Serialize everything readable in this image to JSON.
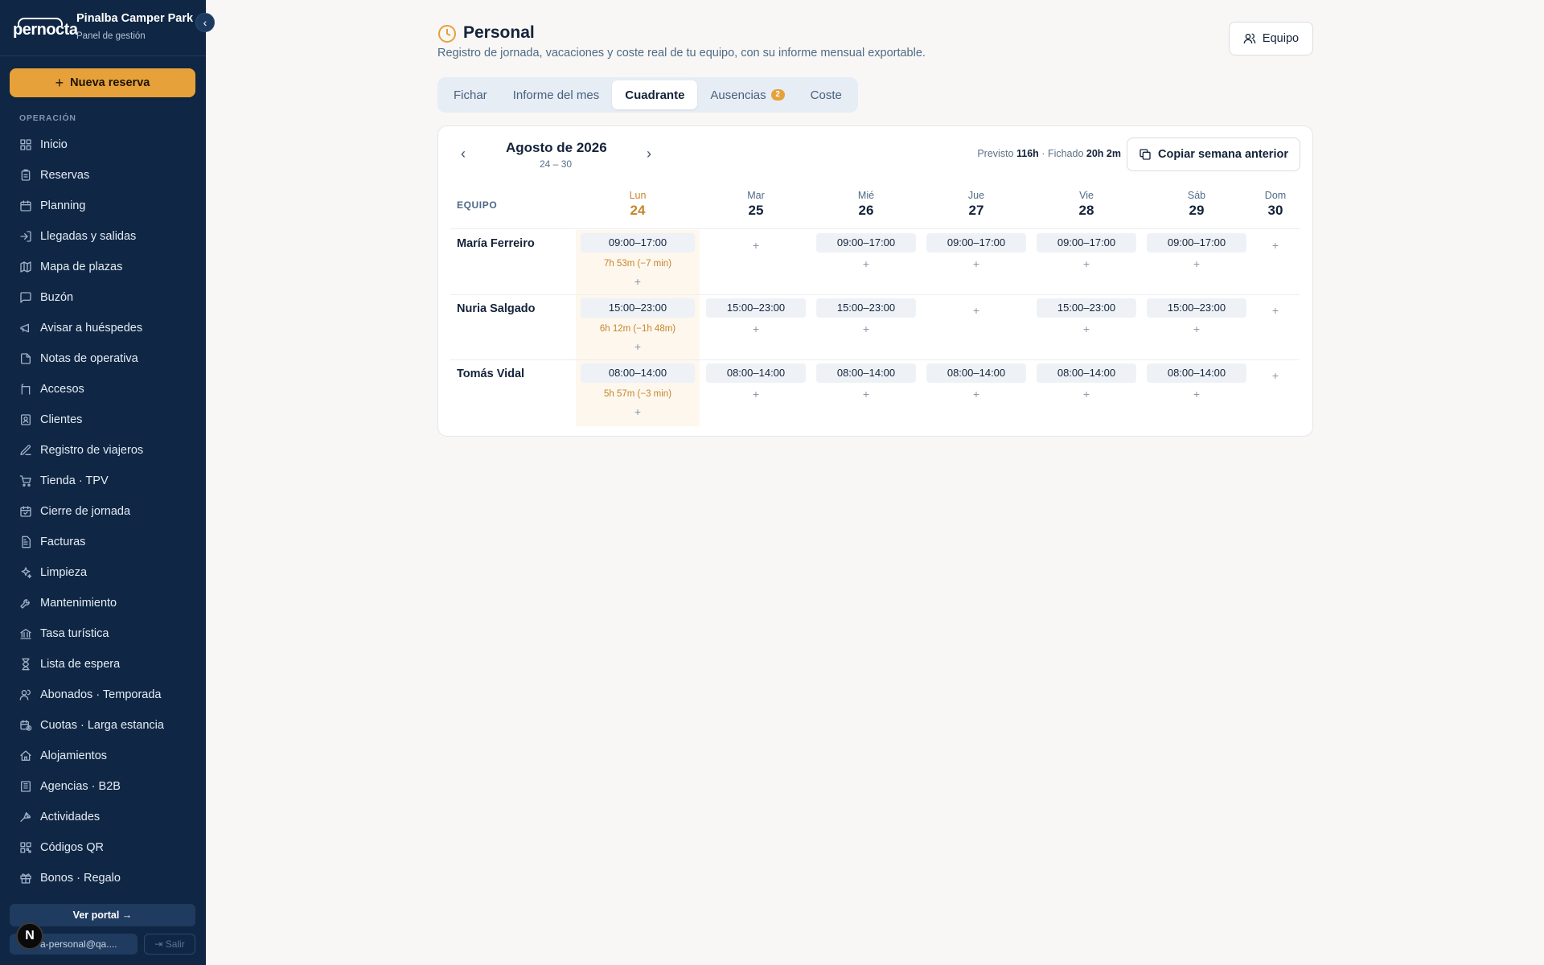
{
  "sidebar": {
    "logo_text": "pernocta",
    "park_name": "Pinalba Camper Park",
    "park_subtitle": "Panel de gestión",
    "new_reservation": "Nueva reserva",
    "section_label": "OPERACIÓN",
    "items": [
      {
        "label": "Inicio",
        "icon": "grid-icon"
      },
      {
        "label": "Reservas",
        "icon": "clipboard-icon"
      },
      {
        "label": "Planning",
        "icon": "calendar-icon"
      },
      {
        "label": "Llegadas y salidas",
        "icon": "login-icon"
      },
      {
        "label": "Mapa de plazas",
        "icon": "map-icon"
      },
      {
        "label": "Buzón",
        "icon": "message-icon"
      },
      {
        "label": "Avisar a huéspedes",
        "icon": "megaphone-icon"
      },
      {
        "label": "Notas de operativa",
        "icon": "note-icon"
      },
      {
        "label": "Accesos",
        "icon": "barrier-icon"
      },
      {
        "label": "Clientes",
        "icon": "contact-icon"
      },
      {
        "label": "Registro de viajeros",
        "icon": "edit-icon"
      },
      {
        "label": "Tienda · TPV",
        "icon": "cart-icon"
      },
      {
        "label": "Cierre de jornada",
        "icon": "calendar-check-icon"
      },
      {
        "label": "Facturas",
        "icon": "invoice-icon"
      },
      {
        "label": "Limpieza",
        "icon": "sparkles-icon"
      },
      {
        "label": "Mantenimiento",
        "icon": "wrench-icon"
      },
      {
        "label": "Tasa turística",
        "icon": "bank-icon"
      },
      {
        "label": "Lista de espera",
        "icon": "hourglass-icon"
      },
      {
        "label": "Abonados · Temporada",
        "icon": "users-icon"
      },
      {
        "label": "Cuotas · Larga estancia",
        "icon": "calendar-clock-icon"
      },
      {
        "label": "Alojamientos",
        "icon": "home-icon"
      },
      {
        "label": "Agencias · B2B",
        "icon": "building-icon"
      },
      {
        "label": "Actividades",
        "icon": "activity-icon"
      },
      {
        "label": "Códigos QR",
        "icon": "qr-icon"
      },
      {
        "label": "Bonos · Regalo",
        "icon": "gift-icon"
      }
    ],
    "portal_button": "Ver portal →",
    "user_email": "a-personal@qa....",
    "logout": "Salir",
    "avatar_letter": "N"
  },
  "header": {
    "title": "Personal",
    "subtitle": "Registro de jornada, vacaciones y coste real de tu equipo, con su informe mensual exportable.",
    "team_button": "Equipo"
  },
  "tabs": [
    {
      "label": "Fichar",
      "active": false
    },
    {
      "label": "Informe del mes",
      "active": false
    },
    {
      "label": "Cuadrante",
      "active": true
    },
    {
      "label": "Ausencias",
      "active": false,
      "badge": "2"
    },
    {
      "label": "Coste",
      "active": false
    }
  ],
  "schedule": {
    "month": "Agosto de 2026",
    "range": "24 – 30",
    "planned_label": "Previsto",
    "planned_value": "116h",
    "separator": "·",
    "clocked_label": "Fichado",
    "clocked_value": "20h 2m",
    "copy_button": "Copiar semana anterior",
    "team_header": "EQUIPO",
    "days": [
      {
        "name": "Lun",
        "num": "24",
        "today": true
      },
      {
        "name": "Mar",
        "num": "25",
        "today": false
      },
      {
        "name": "Mié",
        "num": "26",
        "today": false
      },
      {
        "name": "Jue",
        "num": "27",
        "today": false
      },
      {
        "name": "Vie",
        "num": "28",
        "today": false
      },
      {
        "name": "Sáb",
        "num": "29",
        "today": false
      },
      {
        "name": "Dom",
        "num": "30",
        "today": false
      }
    ],
    "employees": [
      {
        "name": "María Ferreiro",
        "shifts": [
          "09:00–17:00",
          "",
          "09:00–17:00",
          "09:00–17:00",
          "09:00–17:00",
          "09:00–17:00",
          ""
        ],
        "worked_today": "7h 53m (−7 min)"
      },
      {
        "name": "Nuria Salgado",
        "shifts": [
          "15:00–23:00",
          "15:00–23:00",
          "15:00–23:00",
          "",
          "15:00–23:00",
          "15:00–23:00",
          ""
        ],
        "worked_today": "6h 12m (−1h 48m)"
      },
      {
        "name": "Tomás Vidal",
        "shifts": [
          "08:00–14:00",
          "08:00–14:00",
          "08:00–14:00",
          "08:00–14:00",
          "08:00–14:00",
          "08:00–14:00",
          ""
        ],
        "worked_today": "5h 57m (−3 min)"
      }
    ],
    "add_symbol": "+"
  },
  "colors": {
    "sidebar_bg": "#0f2744",
    "accent": "#e6a13a",
    "today_text": "#c4862b"
  }
}
